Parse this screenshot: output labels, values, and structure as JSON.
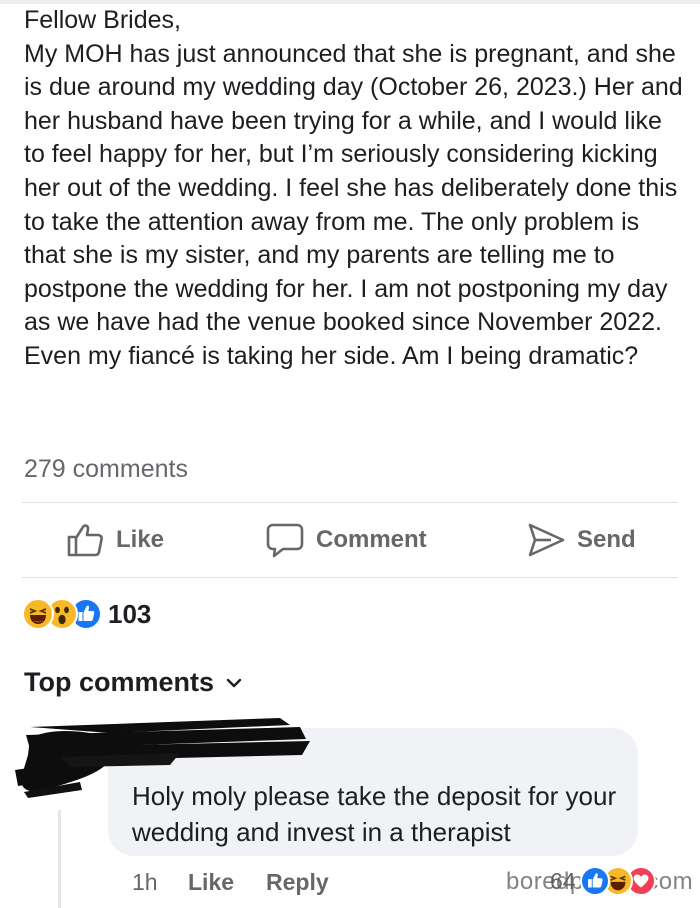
{
  "post": {
    "paragraphs": [
      "Fellow Brides,",
      "My MOH has just announced that she is pregnant, and she is due around my wedding day (October 26, 2023.) Her and her husband have been trying for a while, and I would like to feel happy for her, but I’m seriously considering kicking her out of the wedding. I feel she has deliberately done this to take the attention away from me. The only problem is that she is my sister, and my parents are telling me to postpone the wedding for her. I am not postponing my day as we have had the venue booked since November 2022. Even my fiancé is taking her side. Am I being dramatic?"
    ],
    "comments_count": "279 comments"
  },
  "actions": {
    "like": "Like",
    "comment": "Comment",
    "send": "Send"
  },
  "reactions": {
    "icons": [
      "haha-icon",
      "wow-icon",
      "like-icon"
    ],
    "count": "103"
  },
  "top_comments_label": "Top comments",
  "comment": {
    "text": "Holy moly please take the deposit for your wedding and invest in a therapist",
    "time": "1h",
    "like": "Like",
    "reply": "Reply",
    "reaction_count": "64",
    "reaction_icons": [
      "like-icon",
      "haha-icon",
      "love-icon"
    ]
  },
  "watermark": "boredpanda.com",
  "colors": {
    "text": "#1c1e21",
    "secondary": "#65676b",
    "like_blue": "#1877f2",
    "reaction_yellow": "#f7b928",
    "love_red": "#f33e58",
    "bubble": "#f0f2f5"
  }
}
